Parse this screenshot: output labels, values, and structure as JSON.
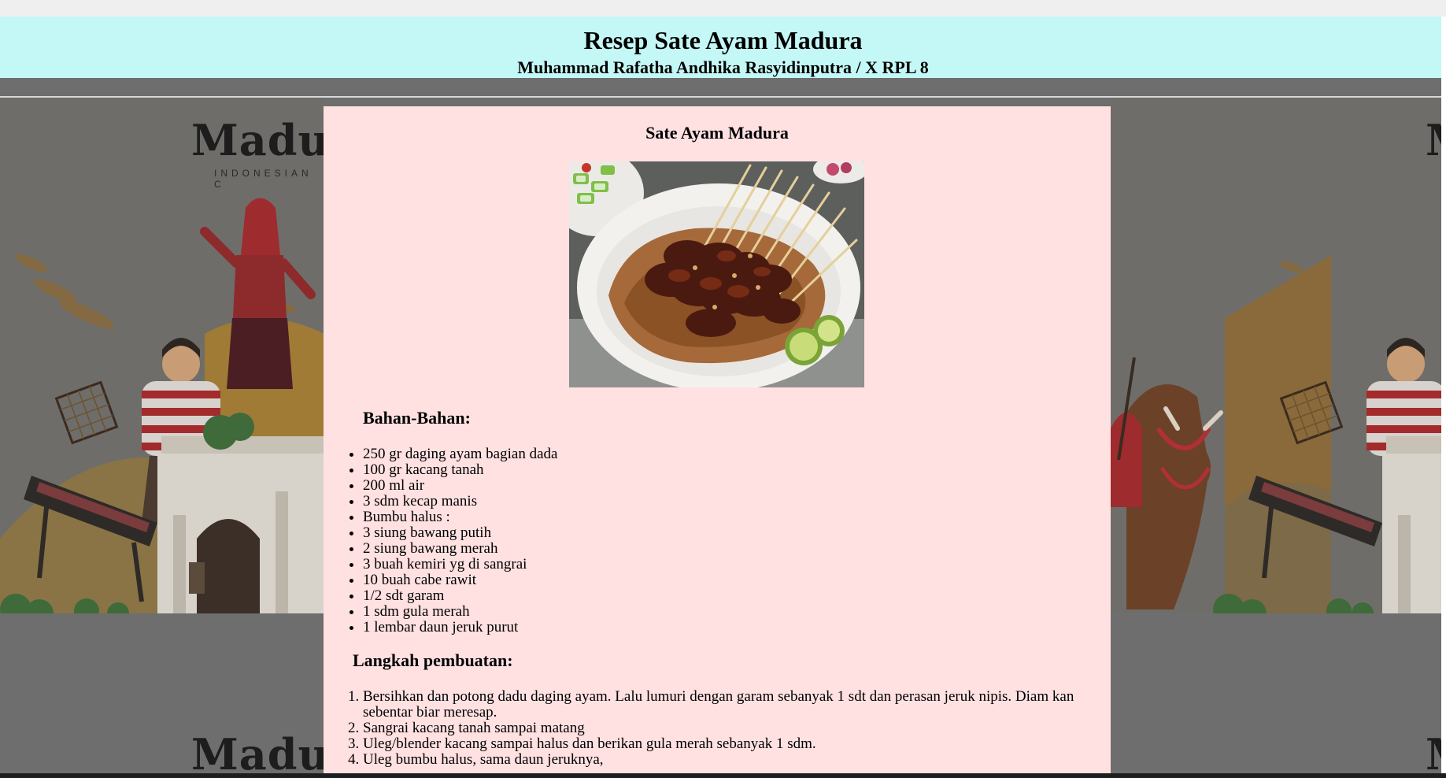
{
  "header": {
    "title": "Resep Sate Ayam Madura",
    "author": "Muhammad Rafatha Andhika Rasyidinputra / X RPL 8"
  },
  "background": {
    "logo_text": "Madura",
    "logo_text_right": "M",
    "logo_subtitle": "INDONESIAN C"
  },
  "card": {
    "title": "Sate Ayam Madura",
    "image_alt": "sate-ayam-photo",
    "ingredients_heading": "Bahan-Bahan:",
    "ingredients": [
      "250 gr daging ayam bagian dada",
      "100 gr kacang tanah",
      "200 ml air",
      "3 sdm kecap manis",
      "Bumbu halus :",
      "3 siung bawang putih",
      "2 siung bawang merah",
      "3 buah kemiri yg di sangrai",
      "10 buah cabe rawit",
      "1/2 sdt garam",
      "1 sdm gula merah",
      "1 lembar daun jeruk purut"
    ],
    "steps_heading": "Langkah pembuatan:",
    "steps": [
      "Bersihkan dan potong dadu daging ayam. Lalu lumuri dengan garam sebanyak 1 sdt dan perasan jeruk nipis. Diam kan sebentar biar meresap.",
      "Sangrai kacang tanah sampai matang",
      "Uleg/blender kacang sampai halus dan berikan gula merah sebanyak 1 sdm.",
      "Uleg bumbu halus, sama daun jeruknya,"
    ]
  },
  "colors": {
    "header_bg": "#c4f8f6",
    "card_bg": "#ffe1e2",
    "page_bg": "#6e6e6e"
  }
}
